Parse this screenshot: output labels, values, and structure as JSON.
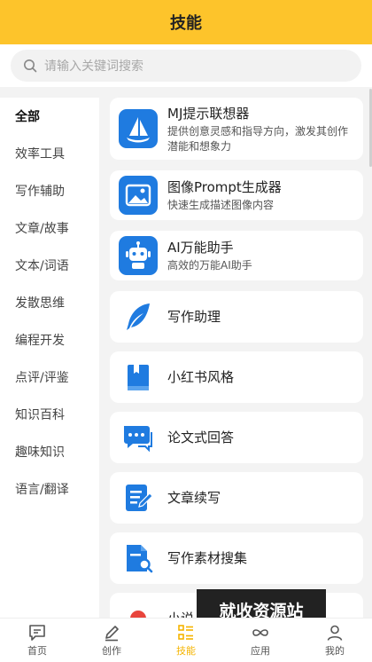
{
  "header": {
    "title": "技能"
  },
  "search": {
    "placeholder": "请输入关键词搜索",
    "icon": "search-icon"
  },
  "sidebar": {
    "items": [
      {
        "label": "全部",
        "active": true
      },
      {
        "label": "效率工具"
      },
      {
        "label": "写作辅助"
      },
      {
        "label": "文章/故事"
      },
      {
        "label": "文本/词语"
      },
      {
        "label": "发散思维"
      },
      {
        "label": "编程开发"
      },
      {
        "label": "点评/评鉴"
      },
      {
        "label": "知识百科"
      },
      {
        "label": "趣味知识"
      },
      {
        "label": "语言/翻译"
      }
    ]
  },
  "skills": [
    {
      "name": "MJ提示联想器",
      "desc": "提供创意灵感和指导方向，激发其创作潜能和想象力",
      "icon": "sailboat-icon"
    },
    {
      "name": "图像Prompt生成器",
      "desc": "快速生成描述图像内容",
      "icon": "image-icon"
    },
    {
      "name": "AI万能助手",
      "desc": "高效的万能AI助手",
      "icon": "robot-icon"
    },
    {
      "name": "写作助理",
      "desc": "",
      "icon": "feather-icon"
    },
    {
      "name": "小红书风格",
      "desc": "",
      "icon": "book-icon"
    },
    {
      "name": "论文式回答",
      "desc": "",
      "icon": "chat-bubbles-icon"
    },
    {
      "name": "文章续写",
      "desc": "",
      "icon": "edit-document-icon"
    },
    {
      "name": "写作素材搜集",
      "desc": "",
      "icon": "document-search-icon"
    }
  ],
  "partial_card_name": "小说",
  "watermark": "就收资源站",
  "tabbar": {
    "items": [
      {
        "label": "首页",
        "icon": "message-icon"
      },
      {
        "label": "创作",
        "icon": "pen-icon"
      },
      {
        "label": "技能",
        "icon": "list-icon",
        "active": true
      },
      {
        "label": "应用",
        "icon": "infinity-icon"
      },
      {
        "label": "我的",
        "icon": "user-icon"
      }
    ]
  },
  "colors": {
    "accent": "#fdc42b",
    "icon_blue": "#1f7be0",
    "tab_active": "#f5b400"
  }
}
